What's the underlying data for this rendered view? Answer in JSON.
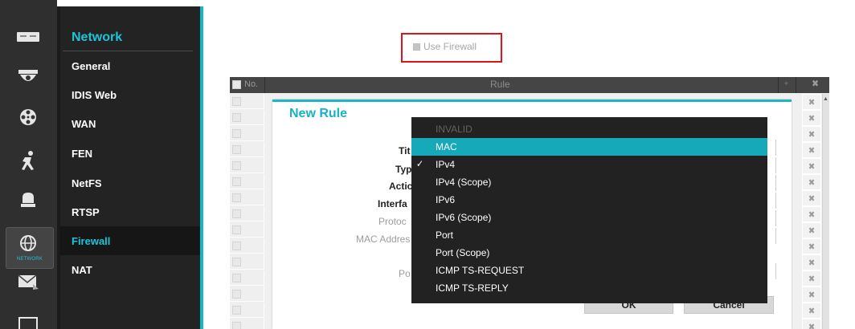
{
  "nav": {
    "rail_icons": [
      "system-icon",
      "camera-icon",
      "record-icon",
      "event-icon",
      "device-icon",
      "network-icon",
      "notification-icon",
      "display-icon"
    ],
    "active_rail_label": "NETWORK",
    "section_title": "Network",
    "items": [
      {
        "label": "General"
      },
      {
        "label": "IDIS Web"
      },
      {
        "label": "WAN"
      },
      {
        "label": "FEN"
      },
      {
        "label": "NetFS"
      },
      {
        "label": "RTSP"
      },
      {
        "label": "Firewall",
        "active": true
      },
      {
        "label": "NAT"
      }
    ]
  },
  "firewall": {
    "use_firewall_label": "Use Firewall",
    "use_firewall_checked": true
  },
  "table": {
    "columns": {
      "no": "No.",
      "rule": "Rule",
      "sort": "÷",
      "delete": "✖"
    },
    "row_count": 15
  },
  "dialog": {
    "title": "New Rule",
    "labels": {
      "title": "Tit",
      "type": "Typ",
      "action": "Actic",
      "interface": "Interfa",
      "protocol": "Protoc",
      "mac_address": "MAC Addres",
      "port": "Po"
    },
    "ok_label": "OK",
    "cancel_label": "Cancel"
  },
  "dropdown": {
    "selected": "IPv4",
    "highlighted": "MAC",
    "options": [
      {
        "label": "INVALID",
        "disabled": true
      },
      {
        "label": "MAC",
        "highlight": true
      },
      {
        "label": "IPv4",
        "checked": true
      },
      {
        "label": "IPv4 (Scope)"
      },
      {
        "label": "IPv6"
      },
      {
        "label": "IPv6 (Scope)"
      },
      {
        "label": "Port"
      },
      {
        "label": "Port (Scope)"
      },
      {
        "label": "ICMP TS-REQUEST"
      },
      {
        "label": "ICMP TS-REPLY"
      }
    ],
    "check_glyph": "✓"
  },
  "colors": {
    "accent": "#16b6c9",
    "highlight_red": "#e0121b",
    "sidebar_bg": "#232323",
    "dropdown_bg": "#222222"
  }
}
